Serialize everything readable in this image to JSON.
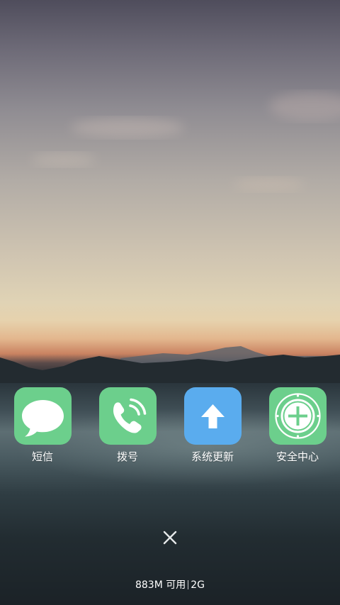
{
  "launcher": {
    "apps": [
      {
        "label": "短信",
        "icon": "message-bubble-icon",
        "color": "#6ccf8c"
      },
      {
        "label": "拨号",
        "icon": "phone-icon",
        "color": "#6ccf8c"
      },
      {
        "label": "系统更新",
        "icon": "upload-arrow-icon",
        "color": "#5aacee"
      },
      {
        "label": "安全中心",
        "icon": "security-cross-icon",
        "color": "#6ccf8c"
      }
    ]
  },
  "recents": {
    "close_icon": "close-icon",
    "memory_available": "883M 可用",
    "memory_total": "2G"
  }
}
